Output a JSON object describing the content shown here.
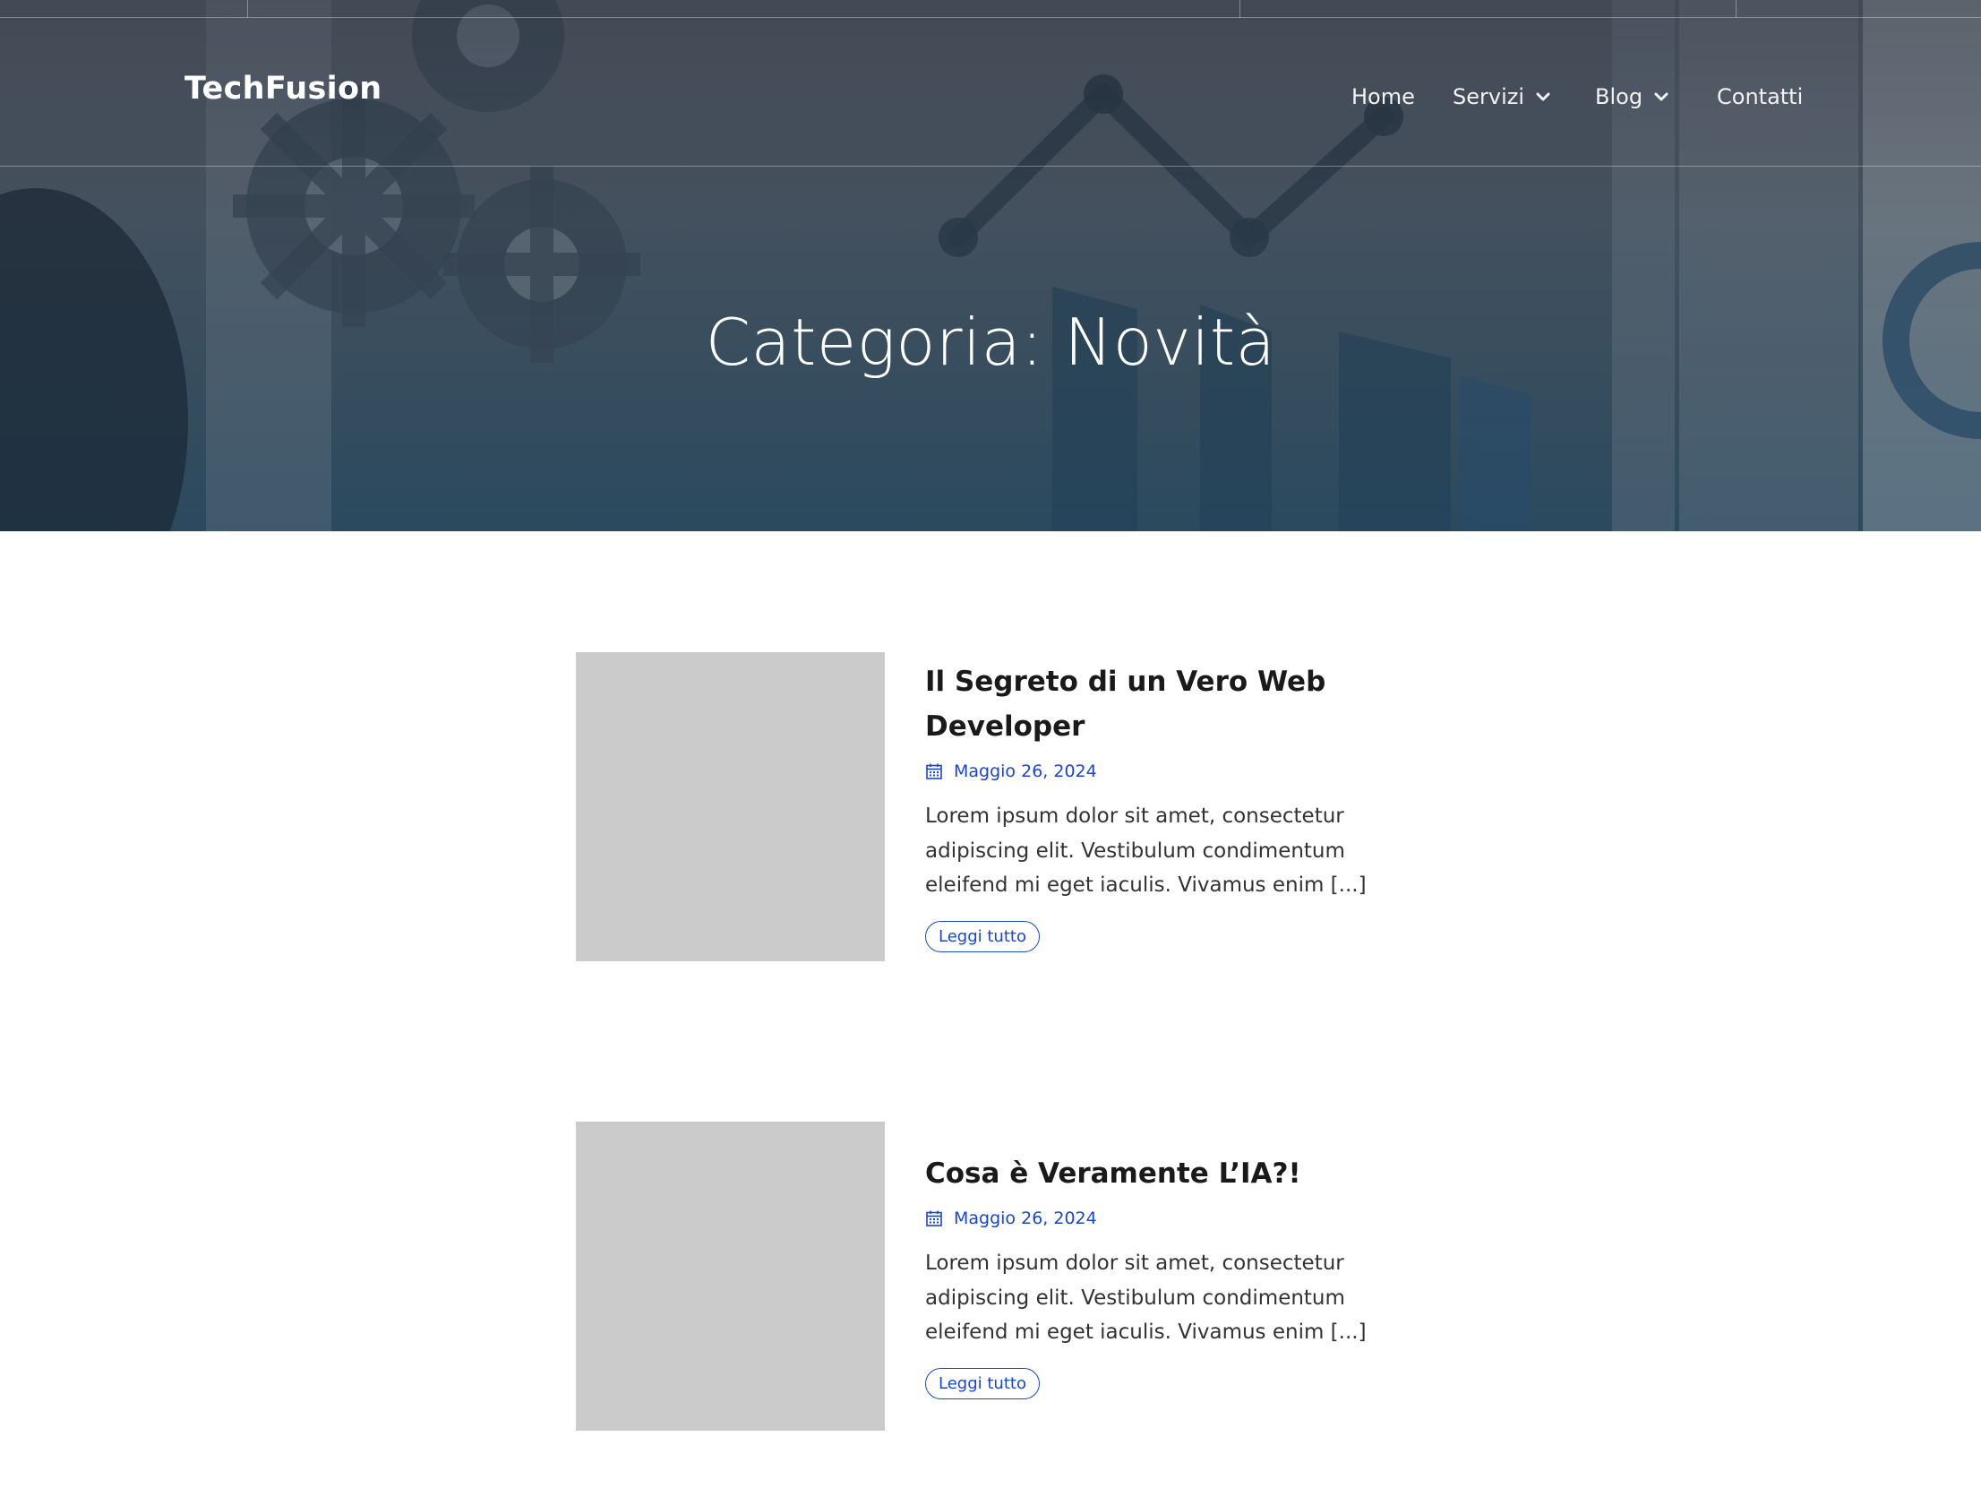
{
  "site": {
    "logo": "TechFusion"
  },
  "nav": {
    "items": [
      {
        "label": "Home",
        "has_dropdown": false
      },
      {
        "label": "Servizi",
        "has_dropdown": true
      },
      {
        "label": "Blog",
        "has_dropdown": true
      },
      {
        "label": "Contatti",
        "has_dropdown": false
      }
    ]
  },
  "hero": {
    "title": "Categoria: Novità"
  },
  "posts": [
    {
      "title": "Il Segreto di un Vero Web Developer",
      "date": "Maggio 26, 2024",
      "excerpt": "Lorem ipsum dolor sit amet, consectetur adipiscing elit. Vestibulum condimentum eleifend mi eget iaculis. Vivamus enim [...]",
      "read_more": "Leggi tutto"
    },
    {
      "title": "Cosa è Veramente L’IA?!",
      "date": "Maggio 26, 2024",
      "excerpt": "Lorem ipsum dolor sit amet, consectetur adipiscing elit. Vestibulum condimentum eleifend mi eget iaculis. Vivamus enim [...]",
      "read_more": "Leggi tutto"
    }
  ],
  "colors": {
    "accent": "#1a47c8",
    "thumb_placeholder": "#cbcbcb",
    "text": "#333333"
  },
  "icons": {
    "dropdown": "chevron-down-icon",
    "date": "calendar-icon"
  }
}
